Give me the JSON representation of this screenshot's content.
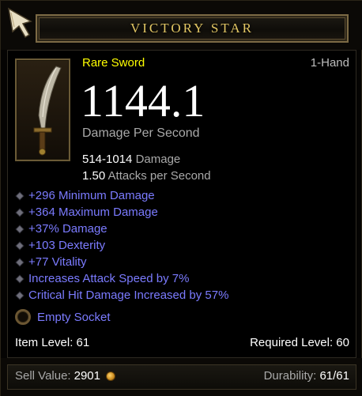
{
  "item": {
    "name": "VICTORY STAR",
    "rarity_type": "Rare Sword",
    "hand": "1-Hand",
    "dps": "1144.1",
    "dps_label": "Damage Per Second",
    "damage_range": "514-1014",
    "damage_label": "Damage",
    "attacks_per_second": "1.50",
    "aps_label": "Attacks per Second"
  },
  "affixes": [
    "+296 Minimum Damage",
    "+364 Maximum Damage",
    "+37% Damage",
    "+103 Dexterity",
    "+77 Vitality",
    "Increases Attack Speed by 7%",
    "Critical Hit Damage Increased by 57%"
  ],
  "socket": {
    "label": "Empty Socket"
  },
  "levels": {
    "item_level": "Item Level: 61",
    "required_level": "Required Level: 60"
  },
  "footer": {
    "sell_label": "Sell Value:",
    "sell_value": "2901",
    "durability_label": "Durability:",
    "durability_value": "61/61"
  },
  "colors": {
    "title_gold": "#e3c764",
    "rare_yellow": "#ffff00",
    "magic_blue": "#7b7bff",
    "white": "#ffffff",
    "grey": "#a9a9a9"
  },
  "icons": [
    "cursor-icon",
    "sword-icon",
    "bullet-diamond-icon",
    "socket-icon",
    "gold-coin-icon"
  ]
}
